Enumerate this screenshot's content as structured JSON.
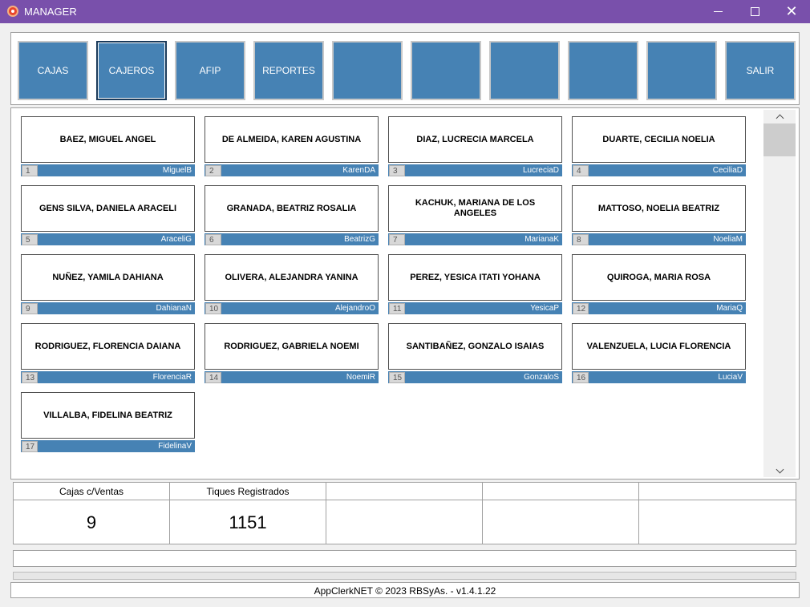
{
  "window": {
    "title": "MANAGER"
  },
  "toolbar": {
    "buttons": [
      {
        "label": "CAJAS"
      },
      {
        "label": "CAJEROS"
      },
      {
        "label": "AFIP"
      },
      {
        "label": "REPORTES"
      },
      {
        "label": ""
      },
      {
        "label": ""
      },
      {
        "label": ""
      },
      {
        "label": ""
      },
      {
        "label": ""
      },
      {
        "label": "SALIR"
      }
    ],
    "active": "CAJEROS"
  },
  "cashiers": [
    {
      "num": "1",
      "name": "BAEZ, MIGUEL ANGEL",
      "user": "MiguelB"
    },
    {
      "num": "2",
      "name": "DE ALMEIDA, KAREN AGUSTINA",
      "user": "KarenDA"
    },
    {
      "num": "3",
      "name": "DIAZ, LUCRECIA MARCELA",
      "user": "LucreciaD"
    },
    {
      "num": "4",
      "name": "DUARTE, CECILIA NOELIA",
      "user": "CeciliaD"
    },
    {
      "num": "5",
      "name": "GENS SILVA, DANIELA ARACELI",
      "user": "AraceliG"
    },
    {
      "num": "6",
      "name": "GRANADA, BEATRIZ ROSALIA",
      "user": "BeatrizG"
    },
    {
      "num": "7",
      "name": "KACHUK, MARIANA DE LOS ANGELES",
      "user": "MarianaK"
    },
    {
      "num": "8",
      "name": "MATTOSO, NOELIA BEATRIZ",
      "user": "NoeliaM"
    },
    {
      "num": "9",
      "name": "NUÑEZ, YAMILA DAHIANA",
      "user": "DahianaN"
    },
    {
      "num": "10",
      "name": "OLIVERA, ALEJANDRA YANINA",
      "user": "AlejandroO"
    },
    {
      "num": "11",
      "name": "PEREZ, YESICA ITATI YOHANA",
      "user": "YesicaP"
    },
    {
      "num": "12",
      "name": "QUIROGA, MARIA ROSA",
      "user": "MariaQ"
    },
    {
      "num": "13",
      "name": "RODRIGUEZ, FLORENCIA DAIANA",
      "user": "FlorenciaR"
    },
    {
      "num": "14",
      "name": "RODRIGUEZ, GABRIELA NOEMI",
      "user": "NoemiR"
    },
    {
      "num": "15",
      "name": "SANTIBAÑEZ, GONZALO ISAIAS",
      "user": "GonzaloS"
    },
    {
      "num": "16",
      "name": "VALENZUELA, LUCIA FLORENCIA",
      "user": "LuciaV"
    },
    {
      "num": "17",
      "name": "VILLALBA, FIDELINA BEATRIZ",
      "user": "FidelinaV"
    }
  ],
  "stats": [
    {
      "label": "Cajas c/Ventas",
      "value": "9"
    },
    {
      "label": "Tiques Registrados",
      "value": "1151"
    },
    {
      "label": "",
      "value": ""
    },
    {
      "label": "",
      "value": ""
    },
    {
      "label": "",
      "value": ""
    }
  ],
  "status": {
    "text": ""
  },
  "footer": {
    "text": "AppClerkNET © 2023 RBSyAs. - v1.4.1.22"
  },
  "colors": {
    "titlebar": "#7950ab",
    "accent": "#4682b4"
  }
}
